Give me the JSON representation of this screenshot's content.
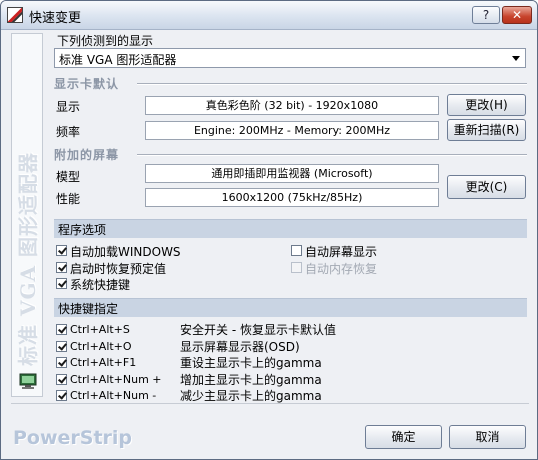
{
  "window": {
    "title": "快速变更",
    "help_label": "?",
    "close_label": "✕"
  },
  "sidebar": {
    "vertical_text": "标准 VGA 图形适配器"
  },
  "detected": {
    "label": "下列侦测到的显示",
    "selected": "标准 VGA 图形适配器"
  },
  "display_group": {
    "heading": "显示卡默认",
    "display_label": "显示",
    "display_value": "真色彩色阶 (32 bit) - 1920x1080",
    "freq_label": "频率",
    "freq_value": "Engine: 200MHz - Memory: 200MHz",
    "change_button": "更改(H)",
    "rescan_button": "重新扫描(R)"
  },
  "screen_group": {
    "heading": "附加的屏幕",
    "model_label": "模型",
    "model_value": "通用即插即用监视器 (Microsoft)",
    "perf_label": "性能",
    "perf_value": "1600x1200 (75kHz/85Hz)",
    "change_button": "更改(C)"
  },
  "program_options": {
    "heading": "程序选项",
    "items": [
      {
        "label": "自动加载WINDOWS",
        "checked": true,
        "disabled": false
      },
      {
        "label": "启动时恢复预定值",
        "checked": true,
        "disabled": false
      },
      {
        "label": "系统快捷键",
        "checked": true,
        "disabled": false
      },
      {
        "label": "自动屏幕显示",
        "checked": false,
        "disabled": false
      },
      {
        "label": "自动内存恢复",
        "checked": false,
        "disabled": true
      }
    ]
  },
  "hotkeys": {
    "heading": "快捷键指定",
    "items": [
      {
        "key": "Ctrl+Alt+S",
        "desc": "安全开关 - 恢复显示卡默认值",
        "checked": true
      },
      {
        "key": "Ctrl+Alt+O",
        "desc": "显示屏幕显示器(OSD)",
        "checked": true
      },
      {
        "key": "Ctrl+Alt+F1",
        "desc": "重设主显示卡上的gamma",
        "checked": true
      },
      {
        "key": "Ctrl+Alt+Num +",
        "desc": "增加主显示卡上的gamma",
        "checked": true
      },
      {
        "key": "Ctrl+Alt+Num -",
        "desc": "减少主显示卡上的gamma",
        "checked": true
      }
    ]
  },
  "footer": {
    "brand": "PowerStrip",
    "ok_button": "确定",
    "cancel_button": "取消"
  }
}
